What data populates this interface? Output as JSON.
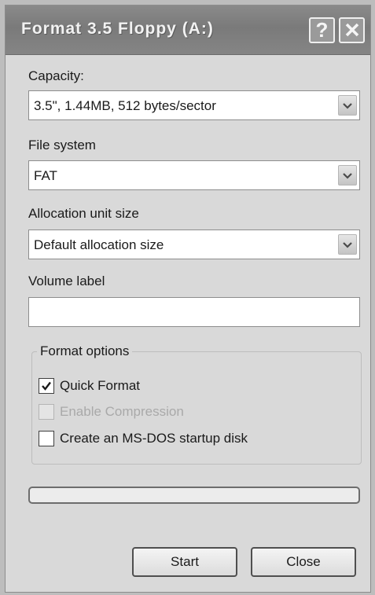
{
  "window": {
    "title": "Format 3.5 Floppy (A:)",
    "help_glyph": "?"
  },
  "capacity": {
    "label": "Capacity:",
    "value": "3.5\",  1.44MB, 512 bytes/sector"
  },
  "file_system": {
    "label": "File system",
    "value": "FAT"
  },
  "allocation": {
    "label": "Allocation unit size",
    "value": "Default allocation size"
  },
  "volume": {
    "label": "Volume label",
    "value": ""
  },
  "format_options": {
    "title": "Format options",
    "quick_format": {
      "label": "Quick Format",
      "checked": true
    },
    "enable_compression": {
      "label": "Enable Compression",
      "checked": false,
      "disabled": true
    },
    "msdos_startup": {
      "label": "Create an MS-DOS startup disk",
      "checked": false
    }
  },
  "progress": {
    "value": 0
  },
  "buttons": {
    "start": "Start",
    "close": "Close"
  },
  "icons": {
    "help": "question-mark-icon",
    "close": "close-x-icon",
    "dropdown": "chevron-down-icon",
    "check": "checkmark-icon"
  }
}
